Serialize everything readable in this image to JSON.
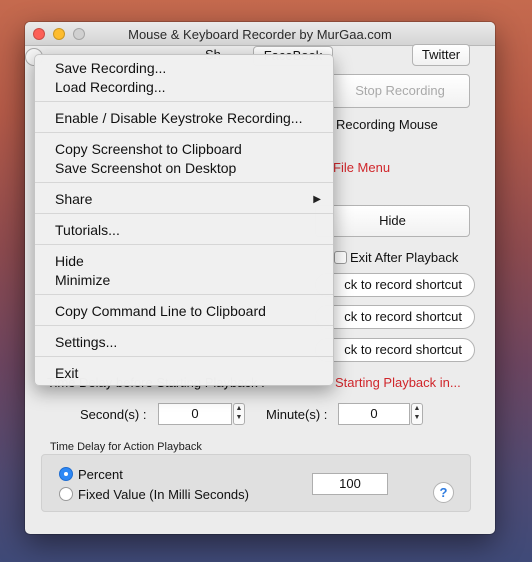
{
  "window": {
    "title": "Mouse & Keyboard Recorder by MurGaa.com"
  },
  "top": {
    "partial_label_1": "Sh",
    "facebook_partial": "FaceBook",
    "twitter_label": "Twitter"
  },
  "controls": {
    "stop_recording": "Stop Recording",
    "recording_mouse": "Recording Mouse",
    "file_menu": "File Menu",
    "hide": "Hide",
    "exit_after_playback": "Exit After Playback",
    "shortcut_1": "ck to record shortcut",
    "shortcut_2": "ck to record shortcut",
    "shortcut_3": "ck to record shortcut",
    "time_delay_start_partial": "Time Delay before Starting Playback :",
    "starting_playback": "Starting Playback in..."
  },
  "delay": {
    "seconds_label": "Second(s) :",
    "seconds_value": "0",
    "minutes_label": "Minute(s) :",
    "minutes_value": "0"
  },
  "action_delay": {
    "group_label": "Time Delay for Action Playback",
    "percent_label": "Percent",
    "fixed_label": "Fixed Value (In Milli Seconds)",
    "value": "100",
    "selected": "Percent",
    "help": "?"
  },
  "menu": {
    "items": [
      "Save Recording...",
      "Load Recording...",
      "Enable / Disable Keystroke Recording...",
      "Copy Screenshot to Clipboard",
      "Save Screenshot on Desktop",
      "Share",
      "Tutorials...",
      "Hide",
      "Minimize",
      "Copy Command Line to Clipboard",
      "Settings...",
      "Exit"
    ],
    "submenu_arrow": "▶"
  },
  "colors": {
    "accent_red": "#d0262b",
    "radio_selected": "#2d88f5"
  }
}
